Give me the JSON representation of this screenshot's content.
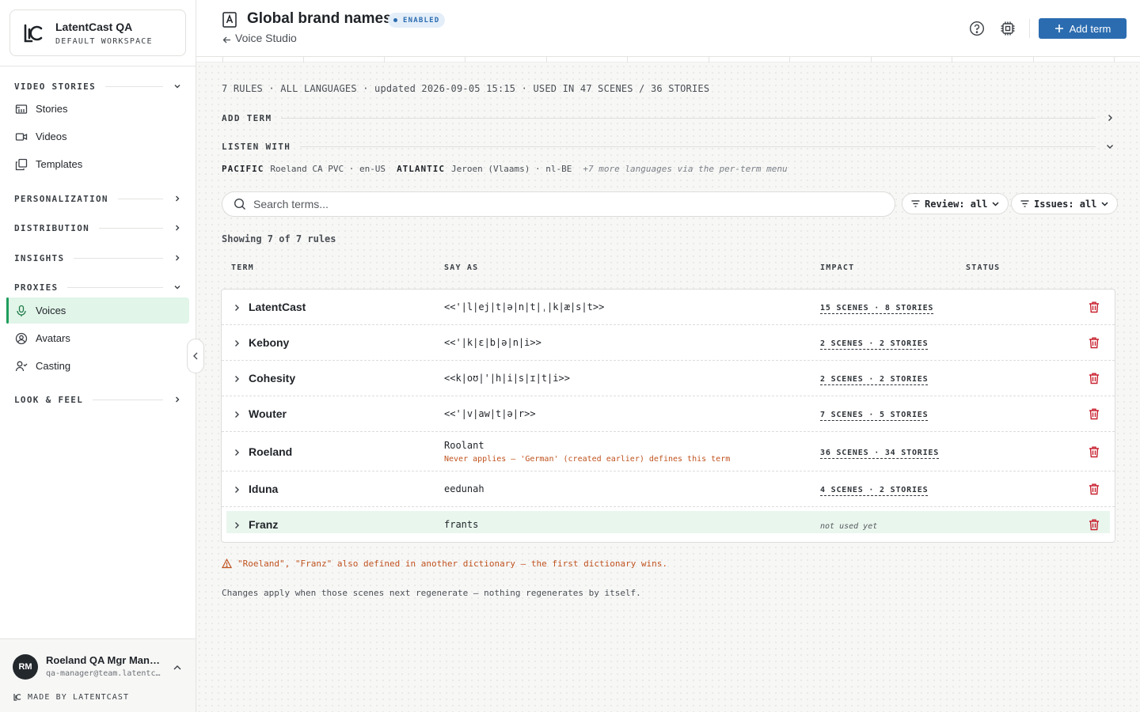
{
  "workspace": {
    "name": "LatentCast QA",
    "subtitle": "DEFAULT WORKSPACE"
  },
  "sidebar": {
    "sections": [
      {
        "label": "VIDEO STORIES",
        "expanded": true
      },
      {
        "label": "PERSONALIZATION",
        "expanded": false
      },
      {
        "label": "DISTRIBUTION",
        "expanded": false
      },
      {
        "label": "INSIGHTS",
        "expanded": false
      },
      {
        "label": "PROXIES",
        "expanded": true
      },
      {
        "label": "LOOK & FEEL",
        "expanded": false
      }
    ],
    "items": [
      {
        "label": "Stories",
        "icon": "stories-icon"
      },
      {
        "label": "Videos",
        "icon": "video-icon"
      },
      {
        "label": "Templates",
        "icon": "templates-icon"
      },
      {
        "label": "Voices",
        "icon": "microphone-icon",
        "active": true
      },
      {
        "label": "Avatars",
        "icon": "avatar-icon"
      },
      {
        "label": "Casting",
        "icon": "casting-icon"
      }
    ]
  },
  "user": {
    "initials": "RM",
    "name": "Roeland QA Mgr Manager",
    "email": "qa-manager@team.latentcast.com",
    "made_by": "MADE BY LATENTCAST"
  },
  "header": {
    "title": "Global brand names",
    "badge": "ENABLED",
    "back_label": "Voice Studio",
    "add_label": "Add term"
  },
  "meta": {
    "text": "7 RULES · ALL LANGUAGES · updated 2026-09-05 15:15 · USED IN 47 SCENES / 36 STORIES"
  },
  "groups": {
    "add_term": "ADD TERM",
    "listen_with": "LISTEN WITH"
  },
  "voices": {
    "pacific_label": "PACIFIC",
    "pacific_value": "Roeland CA PVC · en-US",
    "atlantic_label": "ATLANTIC",
    "atlantic_value": "Jeroen (Vlaams) · nl-BE",
    "more": "+7 more languages via the per-term menu"
  },
  "search": {
    "placeholder": "Search terms..."
  },
  "filters": {
    "review": "Review: all",
    "issues": "Issues: all"
  },
  "showing": "Showing 7 of 7 rules",
  "table": {
    "headers": {
      "term": "TERM",
      "say_as": "SAY AS",
      "impact": "IMPACT",
      "status": "STATUS"
    },
    "rows": [
      {
        "term": "LatentCast",
        "say_as": "<<'|l|ej|t|ə|n|t|ˌ|k|æ|s|t>>",
        "impact": "15 SCENES · 8 STORIES"
      },
      {
        "term": "Kebony",
        "say_as": "<<'|k|ɛ|b|ə|n|i>>",
        "impact": "2 SCENES · 2 STORIES"
      },
      {
        "term": "Cohesity",
        "say_as": "<<k|oʊ|'|h|i|s|ɪ|t|i>>",
        "impact": "2 SCENES · 2 STORIES"
      },
      {
        "term": "Wouter",
        "say_as": "<<'|v|aw|t|ə|r>>",
        "impact": "7 SCENES · 5 STORIES"
      },
      {
        "term": "Roeland",
        "say_as": "Roolant",
        "warning": "Never applies — 'German' (created earlier) defines this term",
        "impact": "36 SCENES · 34 STORIES"
      },
      {
        "term": "Iduna",
        "say_as": "eedunah",
        "impact": "4 SCENES · 2 STORIES"
      },
      {
        "term": "Franz",
        "say_as": "frants",
        "impact": "not used yet"
      }
    ]
  },
  "conflict": "\"Roeland\", \"Franz\" also defined in another dictionary — the first dictionary wins.",
  "note": "Changes apply when those scenes next regenerate — nothing regenerates by itself.",
  "colors": {
    "accent": "#2b6cb0",
    "active_nav": "#e1f5e9",
    "danger": "#c8202f",
    "warning": "#c0521e"
  }
}
